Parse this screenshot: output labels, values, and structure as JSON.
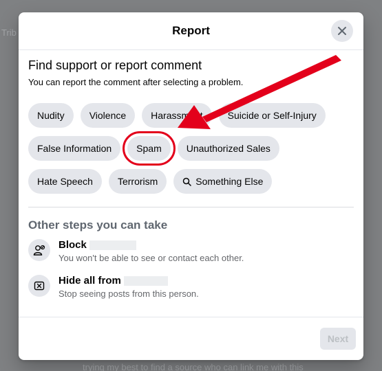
{
  "backdrop": {
    "left_text": "Trib",
    "bottom_text": "trying my best to find a source who can link me with this"
  },
  "dialog": {
    "title": "Report",
    "heading": "Find support or report comment",
    "subheading": "You can report the comment after selecting a problem.",
    "chip_rows": [
      [
        {
          "label": "Nudity"
        },
        {
          "label": "Violence"
        },
        {
          "label": "Harassment"
        },
        {
          "label": "Suicide or Self-Injury"
        }
      ],
      [
        {
          "label": "False Information"
        },
        {
          "label": "Spam"
        },
        {
          "label": "Unauthorized Sales"
        }
      ],
      [
        {
          "label": "Hate Speech"
        },
        {
          "label": "Terrorism"
        },
        {
          "label": "Something Else",
          "icon": "search-icon"
        }
      ]
    ],
    "other_steps_title": "Other steps you can take",
    "steps": [
      {
        "name": "Block",
        "desc": "You won't be able to see or contact each other.",
        "icon": "block-user-icon"
      },
      {
        "name": "Hide all from",
        "desc": "Stop seeing posts from this person.",
        "icon": "hide-icon"
      }
    ],
    "next_label": "Next"
  },
  "annotation": {
    "highlight_target": "Spam",
    "highlight_color": "#e3001b"
  }
}
